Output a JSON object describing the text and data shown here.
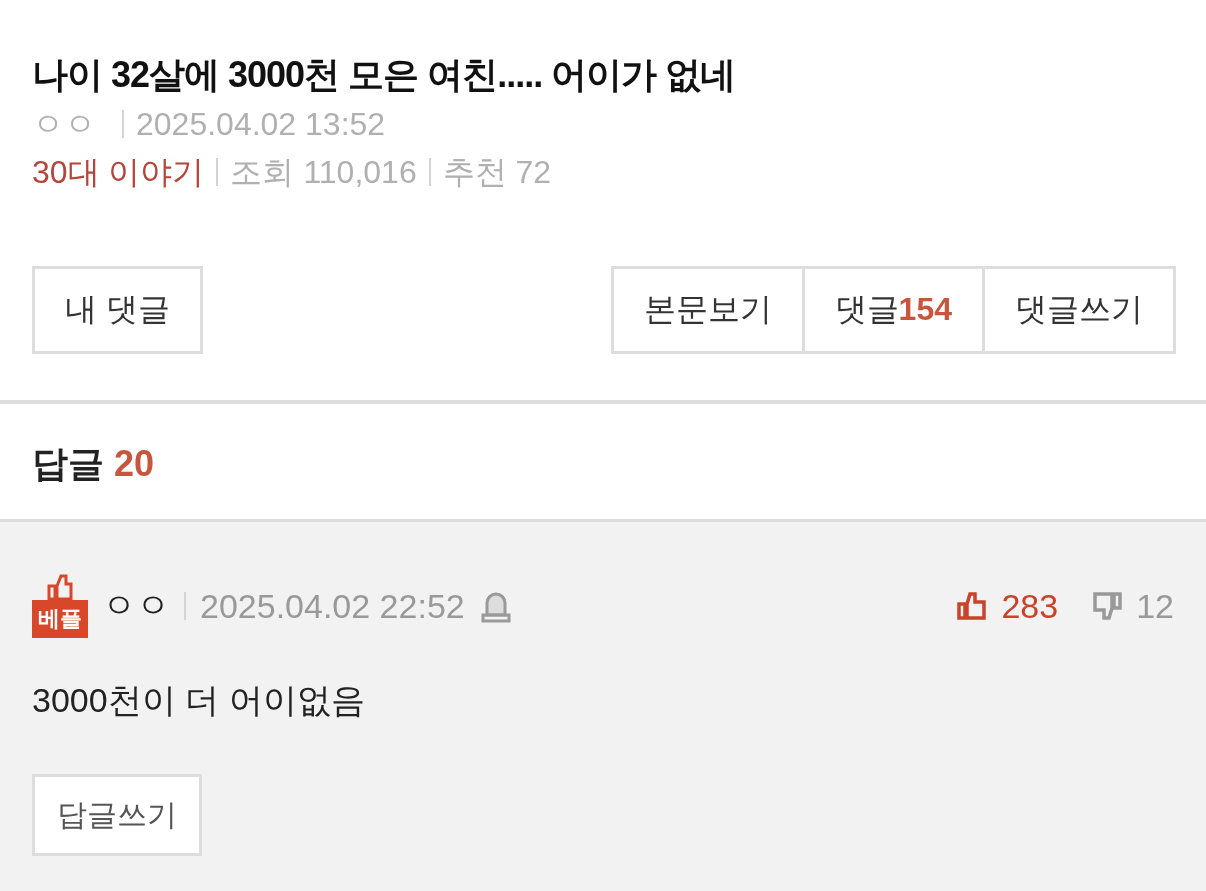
{
  "post": {
    "title": "나이 32살에 3000천 모은 여친..... 어이가 없네",
    "author": "ㅇㅇ",
    "date": "2025.04.02 13:52",
    "category": "30대 이야기",
    "views_label": "조회",
    "views": "110,016",
    "recommend_label": "추천",
    "recommend": "72"
  },
  "buttons_left": [
    {
      "label": "내 댓글"
    }
  ],
  "buttons_right": [
    {
      "label": "본문보기"
    },
    {
      "label": "댓글",
      "count": "154"
    },
    {
      "label": "댓글쓰기"
    }
  ],
  "replies": {
    "label": "답글",
    "count": "20"
  },
  "comment": {
    "badge": "베플",
    "author": "ㅇㅇ",
    "date": "2025.04.02 22:52",
    "likes": "283",
    "dislikes": "12",
    "body": "3000천이 더 어이없음",
    "reply_button": "답글쓰기"
  }
}
